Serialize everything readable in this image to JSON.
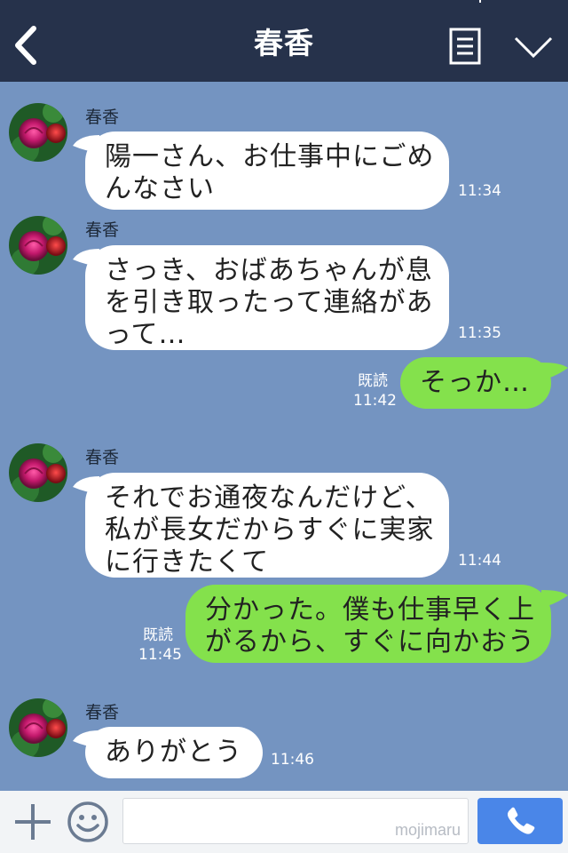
{
  "header": {
    "title": "春香",
    "back_icon": "chevron-left-icon",
    "menu_icon": "menu-list-icon",
    "dropdown_icon": "chevron-down-icon"
  },
  "messages": [
    {
      "sender": "春香",
      "text": "陽一さん、お仕事中にごめ\nんなさい",
      "time": "11:34"
    },
    {
      "sender": "春香",
      "text": "さっき、おばあちゃんが息\nを引き取ったって連絡があ\nって…",
      "time": "11:35"
    },
    {
      "sender": "me",
      "text": "そっか…",
      "read": "既読",
      "time": "11:42"
    },
    {
      "sender": "春香",
      "text": "それでお通夜なんだけど、\n私が長女だからすぐに実家\nに行きたくて",
      "time": "11:44"
    },
    {
      "sender": "me",
      "text": "分かった。僕も仕事早く上\nがるから、すぐに向かおう",
      "read": "既読",
      "time": "11:45"
    },
    {
      "sender": "春香",
      "text": "ありがとう",
      "time": "11:46"
    }
  ],
  "footer": {
    "plus_icon": "plus-icon",
    "sticker_icon": "smiley-icon",
    "input_value": "",
    "watermark": "mojimaru",
    "call_icon": "phone-icon"
  },
  "colors": {
    "header_bg": "#26324b",
    "chat_bg": "#7494c1",
    "bubble_other": "#ffffff",
    "bubble_me": "#84e14c",
    "call_button": "#4a86e8"
  }
}
